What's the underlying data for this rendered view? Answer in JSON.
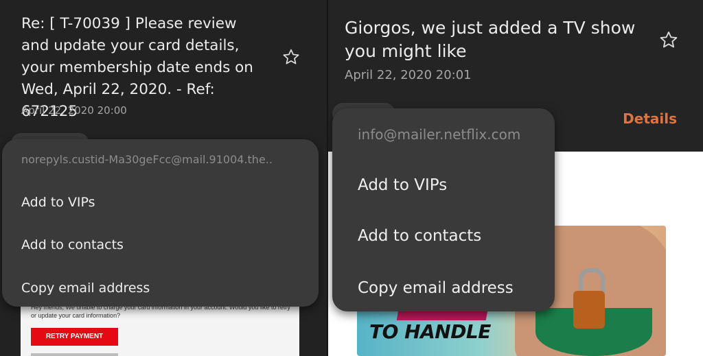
{
  "left": {
    "subject": "Re: [ T-70039 ] Please review and update your card details, your membership date ends on Wed, April 22, 2020. - Ref: 672125",
    "date": "April 22, 2020  20:00",
    "email_body": {
      "text": "Hey friends, We unable to charge your card information in your account. Would you like to retry or update your card information?",
      "retry_button": "RETRY PAYMENT"
    },
    "menu": {
      "email": "norepyls.custid-Ma30geFcc@mail.91004.the..",
      "items": [
        "Add to VIPs",
        "Add to contacts",
        "Copy email address"
      ]
    }
  },
  "right": {
    "subject": "Giorgos, we just added a TV show you might like",
    "date": "April 22, 2020  20:01",
    "details": "Details",
    "promo_title": "TO HANDLE",
    "menu": {
      "email": "info@mailer.netflix.com",
      "items": [
        "Add to VIPs",
        "Add to contacts",
        "Copy email address"
      ]
    }
  },
  "icons": {
    "star": "star-outline-icon"
  },
  "colors": {
    "accent": "#e0733f",
    "retry": "#e50914",
    "menu_bg": "#3a3a3a"
  }
}
